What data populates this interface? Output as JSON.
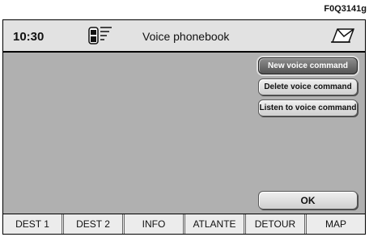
{
  "figure_code": "F0Q3141g",
  "header": {
    "time": "10:30",
    "title": "Voice phonebook"
  },
  "menu": {
    "buttons": [
      {
        "label": "New voice command",
        "active": true
      },
      {
        "label": "Delete voice command",
        "active": false
      },
      {
        "label": "Listen to voice command",
        "active": false
      }
    ],
    "ok_label": "OK"
  },
  "bottom_tabs": [
    "DEST 1",
    "DEST 2",
    "INFO",
    "ATLANTE",
    "DETOUR",
    "MAP"
  ],
  "icons": {
    "phone": "phone-signal-icon",
    "message": "message-envelope-icon"
  },
  "colors": {
    "screen_bg": "#b0b0b0",
    "bar_bg": "#e2e2e2",
    "active_button": "#6e6e6e"
  }
}
